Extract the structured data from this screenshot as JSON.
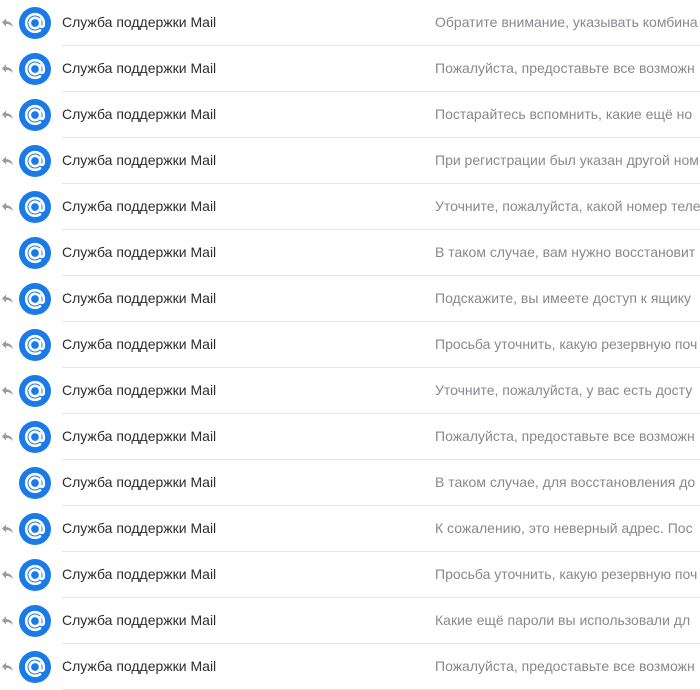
{
  "icons": {
    "avatar": "mail-at-icon",
    "reply": "reply-arrow-icon"
  },
  "colors": {
    "avatar_bg": "#1a7ae8",
    "sender_text": "#2c2d2e",
    "snippet_text": "#87898f",
    "reply_icon": "#9a9ca1"
  },
  "messages": [
    {
      "sender": "Служба поддержки Mail",
      "snippet": "Обратите внимание, указывать комбина",
      "replied": true
    },
    {
      "sender": "Служба поддержки Mail",
      "snippet": "Пожалуйста, предоставьте все возможн",
      "replied": true
    },
    {
      "sender": "Служба поддержки Mail",
      "snippet": "Постарайтесь вспомнить, какие ещё но",
      "replied": true
    },
    {
      "sender": "Служба поддержки Mail",
      "snippet": "При регистрации был указан другой ном",
      "replied": true
    },
    {
      "sender": "Служба поддержки Mail",
      "snippet": "Уточните, пожалуйста, какой номер теле",
      "replied": true
    },
    {
      "sender": "Служба поддержки Mail",
      "snippet": "В таком случае, вам нужно восстановит",
      "replied": false
    },
    {
      "sender": "Служба поддержки Mail",
      "snippet": "Подскажите, вы имеете доступ к ящику",
      "replied": true
    },
    {
      "sender": "Служба поддержки Mail",
      "snippet": "Просьба уточнить, какую резервную поч",
      "replied": true
    },
    {
      "sender": "Служба поддержки Mail",
      "snippet": "Уточните, пожалуйста, у вас есть досту",
      "replied": true
    },
    {
      "sender": "Служба поддержки Mail",
      "snippet": "Пожалуйста, предоставьте все возможн",
      "replied": true
    },
    {
      "sender": "Служба поддержки Mail",
      "snippet": "В таком случае, для восстановления до",
      "replied": false
    },
    {
      "sender": "Служба поддержки Mail",
      "snippet": "К сожалению, это неверный адрес. Пос",
      "replied": true
    },
    {
      "sender": "Служба поддержки Mail",
      "snippet": "Просьба уточнить, какую резервную поч",
      "replied": true
    },
    {
      "sender": "Служба поддержки Mail",
      "snippet": "Какие ещё пароли вы использовали дл",
      "replied": true
    },
    {
      "sender": "Служба поддержки Mail",
      "snippet": "Пожалуйста, предоставьте все возможн",
      "replied": true
    }
  ]
}
